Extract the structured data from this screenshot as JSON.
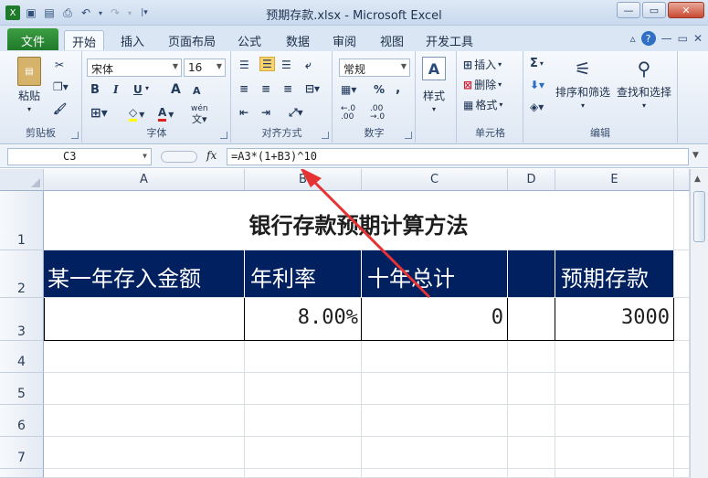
{
  "window": {
    "title": "预期存款.xlsx - Microsoft Excel",
    "controls": {
      "minimize": "—",
      "restore": "▭",
      "close": "✕"
    }
  },
  "tabs": [
    "文件",
    "开始",
    "插入",
    "页面布局",
    "公式",
    "数据",
    "审阅",
    "视图",
    "开发工具"
  ],
  "ribbon": {
    "clipboard": {
      "paste": "粘贴",
      "label": "剪贴板"
    },
    "font": {
      "name": "宋体",
      "size": "16",
      "label": "字体",
      "bold": "B",
      "italic": "I",
      "underline": "U",
      "grow": "A",
      "shrink": "A",
      "pinyin": "wén"
    },
    "alignment": {
      "label": "对齐方式"
    },
    "number": {
      "format": "常规",
      "percent": "%",
      "comma": ",",
      "inc_decimal": ".00→.0",
      "dec_decimal": ".00→.0",
      "label": "数字"
    },
    "styles": {
      "label": "样式"
    },
    "cells": {
      "insert": "插入",
      "delete": "删除",
      "format": "格式",
      "label": "单元格"
    },
    "editing": {
      "sum": "Σ",
      "sort_filter": "排序和筛选",
      "find_select": "查找和选择",
      "label": "编辑"
    }
  },
  "formula_bar": {
    "name_box": "C3",
    "fx": "fx",
    "formula": "=A3*(1+B3)^10"
  },
  "sheet": {
    "columns": [
      "A",
      "B",
      "C",
      "D",
      "E"
    ],
    "rows": [
      "1",
      "2",
      "3",
      "4",
      "5",
      "6",
      "7"
    ],
    "title": "银行存款预期计算方法",
    "headers": {
      "a": "某一年存入金额",
      "b": "年利率",
      "c": "十年总计",
      "d": "",
      "e": "预期存款"
    },
    "row3": {
      "a": "",
      "b": "8.00%",
      "c": "0",
      "d": "",
      "e": "3000"
    }
  },
  "colors": {
    "header_fill": "#002060",
    "file_tab": "#2a8a34",
    "arrow": "#e53333"
  }
}
